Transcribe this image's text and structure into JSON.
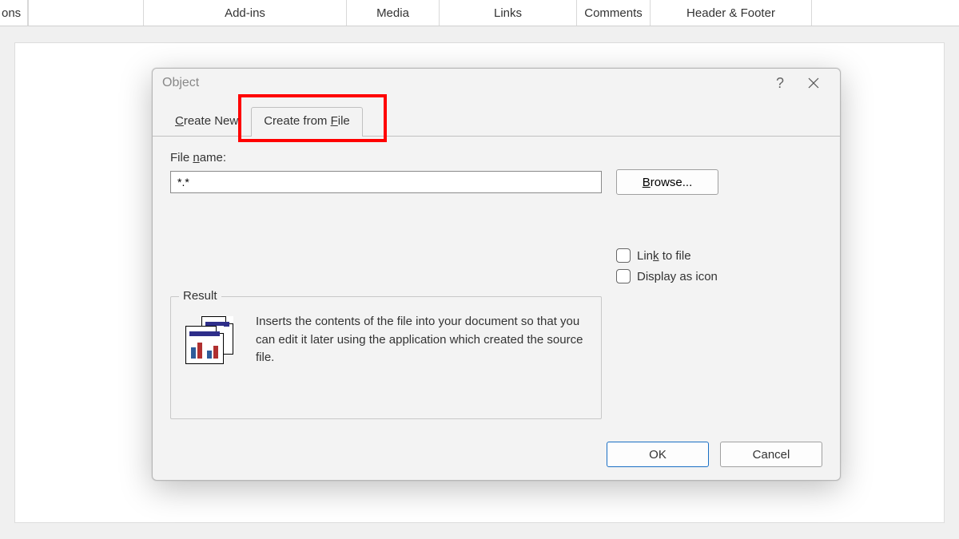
{
  "ribbon": {
    "tabs": [
      "ons",
      "",
      "Add-ins",
      "Media",
      "Links",
      "Comments",
      "Header & Footer"
    ]
  },
  "dialog": {
    "title": "Object",
    "tabs": {
      "create_new_prefix": "C",
      "create_new_rest": "reate New",
      "create_from_file_prefix": "Create from ",
      "create_from_file_underline": "F",
      "create_from_file_rest": "ile"
    },
    "file_label_prefix": "File ",
    "file_label_underline": "n",
    "file_label_rest": "ame:",
    "file_value": "*.*",
    "browse_prefix": "B",
    "browse_rest": "rowse...",
    "checkboxes": {
      "link_prefix": "Lin",
      "link_underline": "k",
      "link_rest": " to file",
      "display": "Display as icon"
    },
    "result": {
      "legend": "Result",
      "text": "Inserts the contents of the file into your document so that you can edit it later using the application which created the source file."
    },
    "buttons": {
      "ok": "OK",
      "cancel": "Cancel"
    }
  }
}
